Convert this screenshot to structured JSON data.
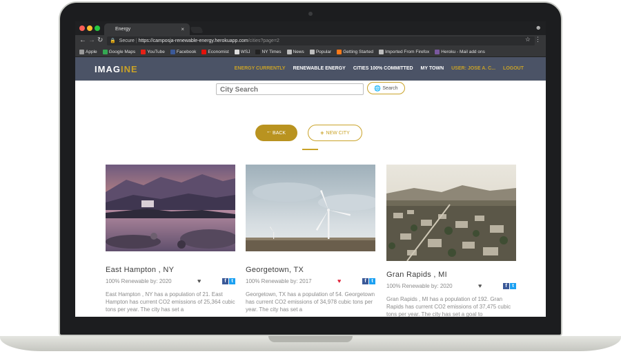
{
  "browser": {
    "tab_title": "Energy",
    "tab_close": "×",
    "secure_label": "Secure",
    "url_host": "https://camposja-renewable-energy.herokuapp.com",
    "url_path": "/cities?page=2",
    "bookmarks": [
      {
        "label": "Apple",
        "icon": "apple-icon",
        "color": "#9a9a9a"
      },
      {
        "label": "Google Maps",
        "icon": "maps-icon",
        "color": "#34a853"
      },
      {
        "label": "YouTube",
        "icon": "youtube-icon",
        "color": "#e62117"
      },
      {
        "label": "Facebook",
        "icon": "facebook-icon",
        "color": "#3b5998"
      },
      {
        "label": "Economist",
        "icon": "economist-icon",
        "color": "#e3120b"
      },
      {
        "label": "WSJ",
        "icon": "wsj-icon",
        "color": "#dddddd"
      },
      {
        "label": "NY Times",
        "icon": "nytimes-icon",
        "color": "#222222"
      },
      {
        "label": "News",
        "icon": "folder-icon",
        "color": "#bdbdbd"
      },
      {
        "label": "Popular",
        "icon": "folder-icon",
        "color": "#bdbdbd"
      },
      {
        "label": "Getting Started",
        "icon": "firefox-icon",
        "color": "#ff7a1a"
      },
      {
        "label": "Imported From Firefox",
        "icon": "folder-icon",
        "color": "#bdbdbd"
      },
      {
        "label": "Heroku - Mail add ons",
        "icon": "heroku-icon",
        "color": "#79589f"
      }
    ]
  },
  "nav": {
    "logo_main": "IMAG",
    "logo_accent": "INE",
    "links": [
      {
        "label": "ENERGY CURRENTLY",
        "active": true
      },
      {
        "label": "RENEWABLE ENERGY",
        "active": false
      },
      {
        "label": "CITIES 100% COMMITTED",
        "active": false
      },
      {
        "label": "MY TOWN",
        "active": false
      },
      {
        "label": "USER: JOSE A. C...",
        "active": true
      },
      {
        "label": "LOGOUT",
        "active": true
      }
    ]
  },
  "search": {
    "placeholder": "City Search",
    "button_label": "Search"
  },
  "actions": {
    "back_label": "BACK",
    "new_city_label": "NEW CITY"
  },
  "cities": [
    {
      "name": "East Hampton , NY",
      "renewable_by": "100% Renewable by: 2020",
      "favorited": false,
      "description": "East Hampton , NY has a population of 21. East Hampton has current CO2 emissions of 25,364 cubic tons per year. The city has set a"
    },
    {
      "name": "Georgetown, TX",
      "renewable_by": "100% Renewable by: 2017",
      "favorited": true,
      "description": "Georgetown, TX has a population of 54. Georgetown has current CO2 emissions of 34,978 cubic tons per year. The city has set a"
    },
    {
      "name": "Gran Rapids , MI",
      "renewable_by": "100% Renewable by: 2020",
      "favorited": false,
      "description": "Gran Rapids , MI has a population of 192. Gran Rapids has current CO2 emissions of 37,475 cubic tons per year. The city has set a goal to"
    }
  ],
  "colors": {
    "accent": "#c9a227",
    "navbar": "#4b5366",
    "heart_active": "#e0243a",
    "heart_inactive": "#555555"
  }
}
